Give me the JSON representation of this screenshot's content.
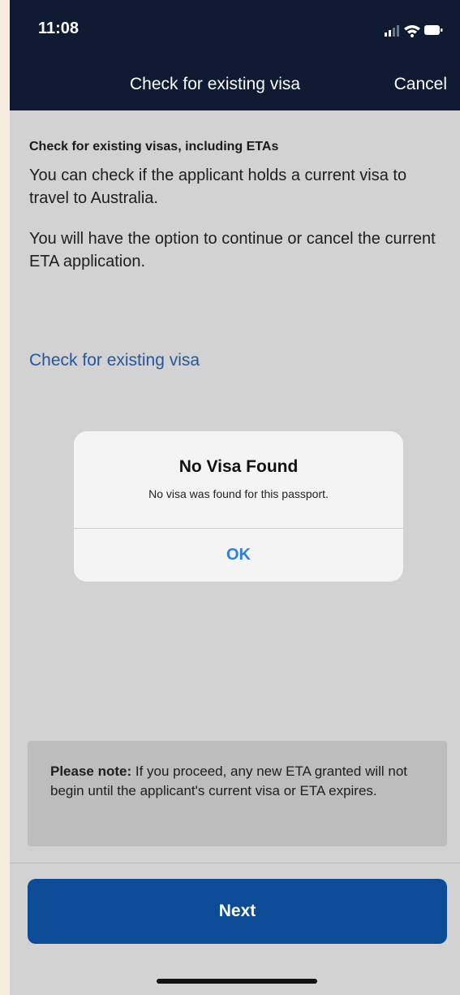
{
  "status_bar": {
    "time": "11:08",
    "icons": [
      "signal-icon",
      "wifi-icon",
      "battery-icon"
    ]
  },
  "nav": {
    "title": "Check for existing visa",
    "cancel_label": "Cancel"
  },
  "content": {
    "heading": "Check for existing visas, including ETAs",
    "paragraph_1": "You can check if the applicant holds a current visa to travel to Australia.",
    "paragraph_2": "You will have the option to continue or cancel the current ETA application.",
    "check_link": "Check for existing visa"
  },
  "dialog": {
    "title": "No Visa Found",
    "message": "No visa was found for this passport.",
    "ok_label": "OK"
  },
  "note": {
    "label": "Please note:",
    "text": " If you proceed, any new ETA granted will not begin until the applicant's current visa or ETA expires."
  },
  "footer": {
    "next_label": "Next"
  },
  "colors": {
    "nav_background": "#0f1a33",
    "link": "#22579f",
    "dialog_button": "#2f7de0",
    "primary_button": "#0c4b95"
  }
}
